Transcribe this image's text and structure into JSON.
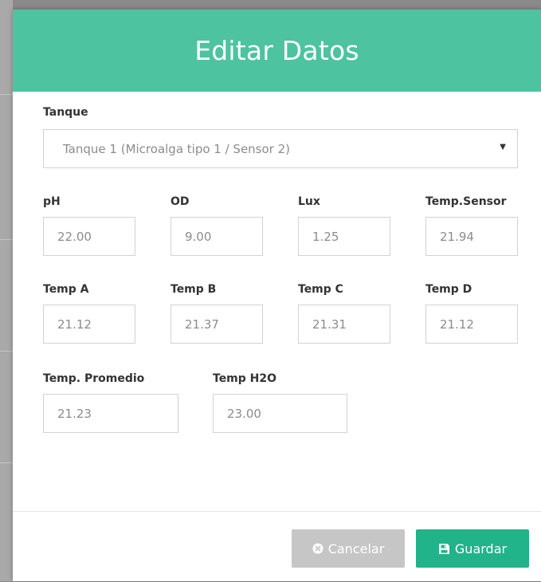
{
  "modal": {
    "title": "Editar Datos"
  },
  "form": {
    "tanque_label": "Tanque",
    "tanque_value": "Tanque 1 (Microalga tipo 1 / Sensor 2)",
    "fields": [
      {
        "label": "pH",
        "value": "22.00"
      },
      {
        "label": "OD",
        "value": "9.00"
      },
      {
        "label": "Lux",
        "value": "1.25"
      },
      {
        "label": "Temp.Sensor",
        "value": "21.94"
      },
      {
        "label": "Temp A",
        "value": "21.12"
      },
      {
        "label": "Temp B",
        "value": "21.37"
      },
      {
        "label": "Temp C",
        "value": "21.31"
      },
      {
        "label": "Temp D",
        "value": "21.12"
      },
      {
        "label": "Temp. Promedio",
        "value": "21.23"
      },
      {
        "label": "Temp H2O",
        "value": "23.00"
      }
    ]
  },
  "footer": {
    "cancel_label": "Cancelar",
    "save_label": "Guardar",
    "cancel_icon": "times-circle-icon",
    "save_icon": "floppy-disk-icon"
  },
  "colors": {
    "header": "#4dc3a0",
    "save_button": "#21b38a",
    "cancel_button": "#c6c6c6"
  }
}
